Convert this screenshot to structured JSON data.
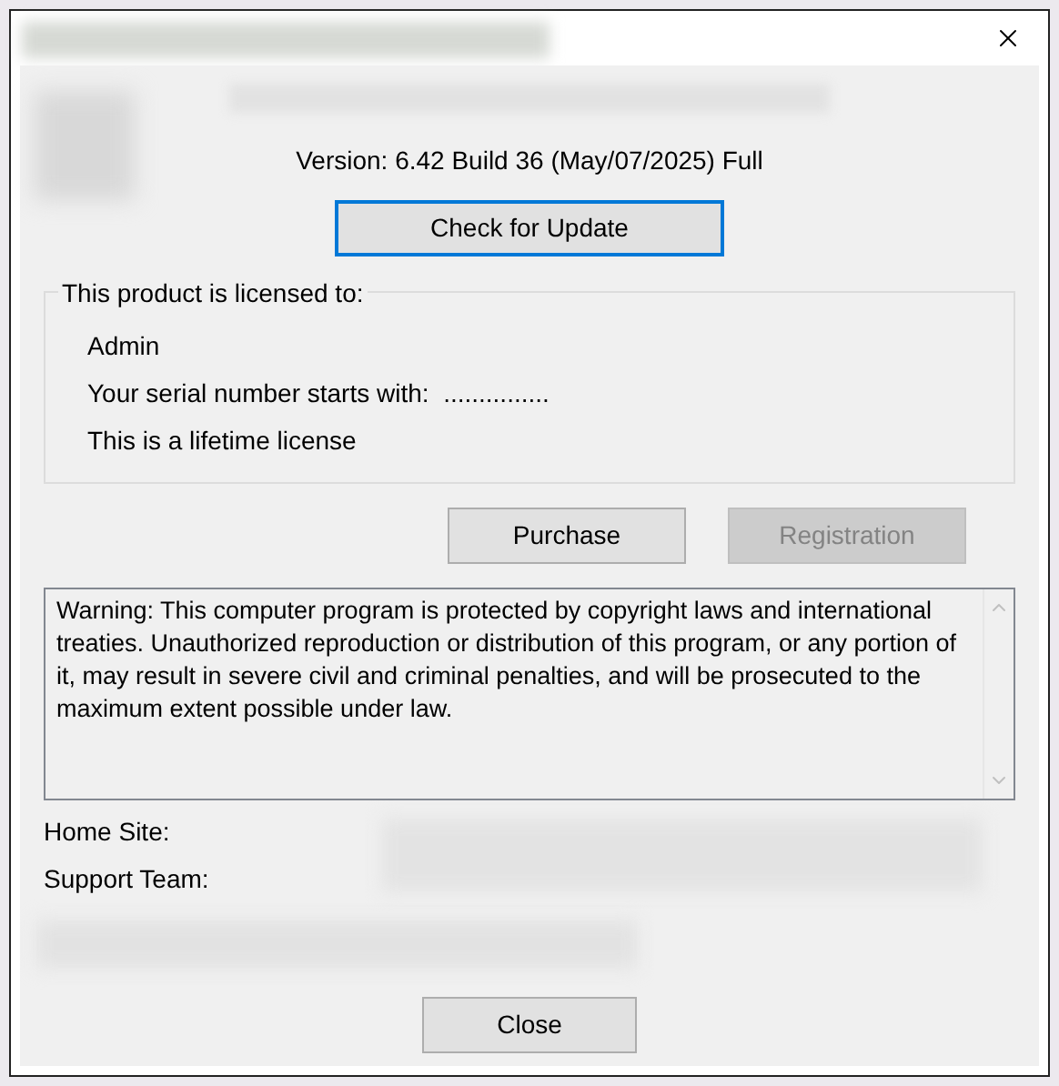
{
  "version": "Version: 6.42 Build 36 (May/07/2025) Full",
  "update_button": {
    "label": "Check for Update",
    "focused": true
  },
  "license": {
    "legend": "This product is licensed to:",
    "lines": [
      "Admin",
      "Your serial number starts with:  ...............",
      "This is a lifetime license"
    ]
  },
  "buttons": [
    {
      "label": "Purchase",
      "disabled": false
    },
    {
      "label": "Registration",
      "disabled": true
    }
  ],
  "warning": "Warning: This computer program is protected by copyright laws and international treaties. Unauthorized reproduction or distribution of this program, or any portion of it, may result in severe civil and criminal penalties, and will be prosecuted to the maximum extent possible under law.",
  "links": [
    {
      "label": "Home Site:"
    },
    {
      "label": "Support Team:"
    }
  ],
  "close_button": "Close"
}
